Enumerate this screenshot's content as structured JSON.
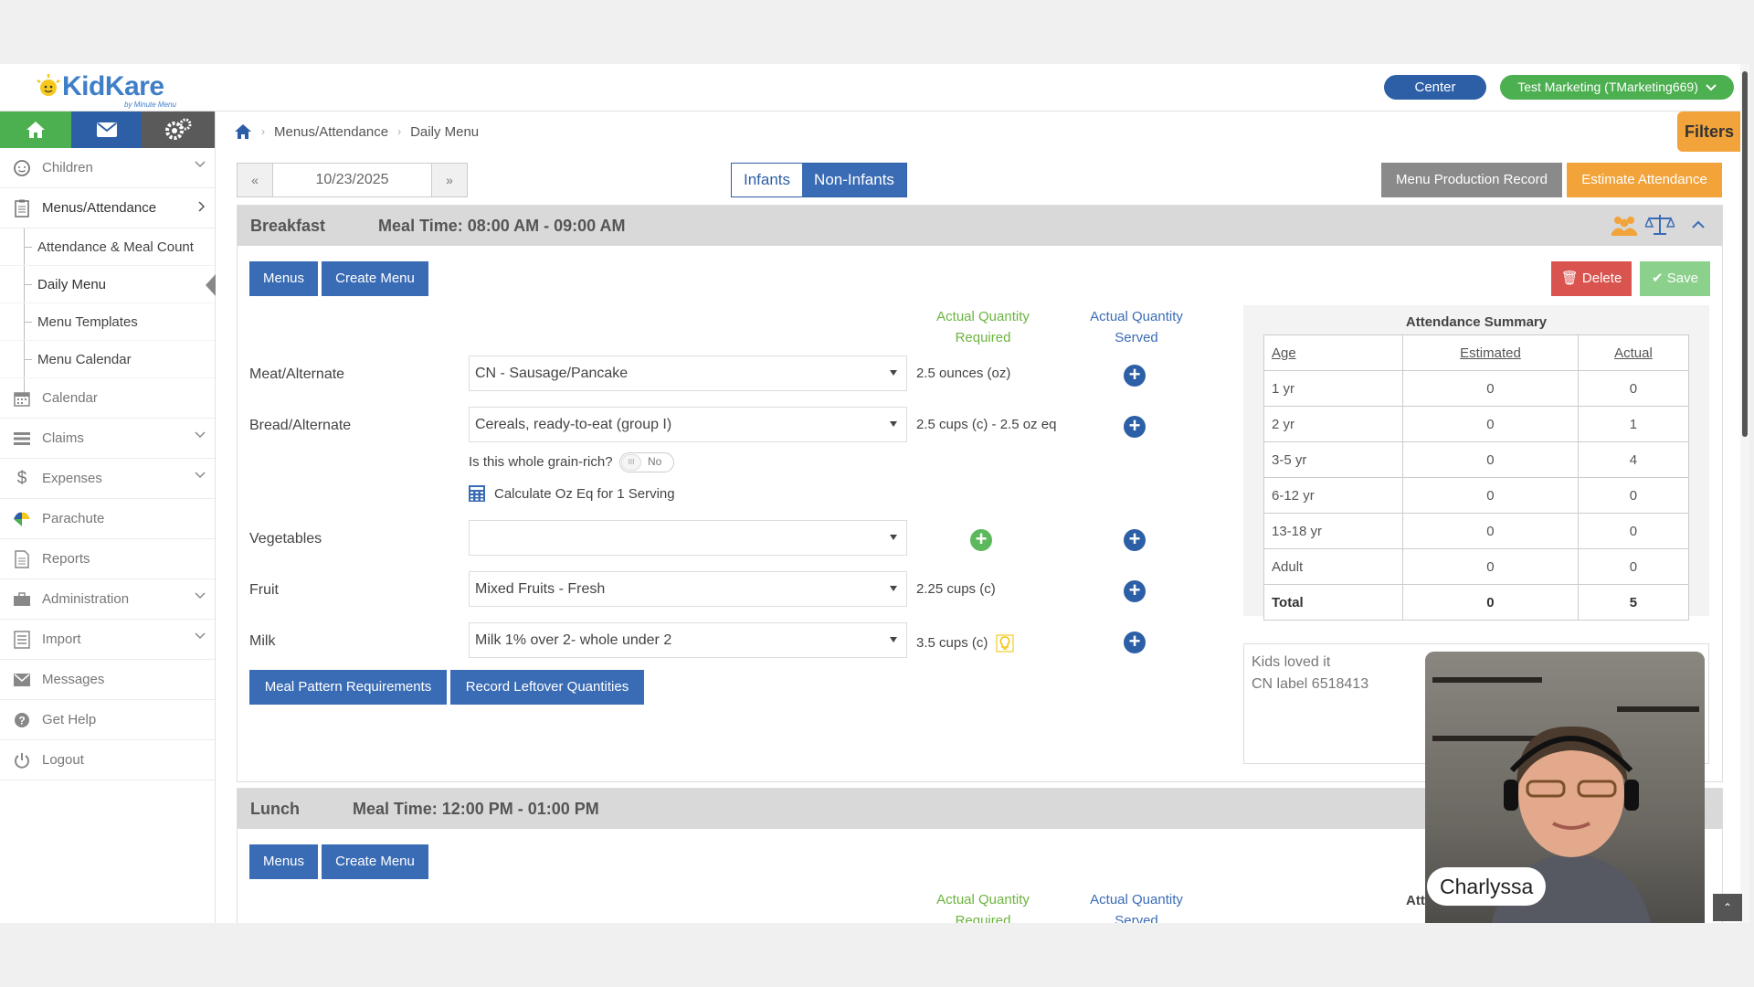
{
  "header": {
    "logo_text": "KidKare",
    "logo_sub": "by Minute Menu",
    "center_label": "Center",
    "account_label": "Test Marketing (TMarketing669)"
  },
  "sidebar": {
    "items": [
      {
        "label": "Children",
        "icon": "child-face-icon",
        "expandable": true
      },
      {
        "label": "Menus/Attendance",
        "icon": "clipboard-icon",
        "expandable": true
      },
      {
        "label": "Calendar",
        "icon": "calendar-icon",
        "expandable": false
      },
      {
        "label": "Claims",
        "icon": "list-icon",
        "expandable": true
      },
      {
        "label": "Expenses",
        "icon": "dollar-icon",
        "expandable": true
      },
      {
        "label": "Parachute",
        "icon": "parachute-icon",
        "expandable": false
      },
      {
        "label": "Reports",
        "icon": "report-icon",
        "expandable": false
      },
      {
        "label": "Administration",
        "icon": "briefcase-icon",
        "expandable": true
      },
      {
        "label": "Import",
        "icon": "import-icon",
        "expandable": true
      },
      {
        "label": "Messages",
        "icon": "envelope-icon",
        "expandable": false
      },
      {
        "label": "Get Help",
        "icon": "question-icon",
        "expandable": false
      },
      {
        "label": "Logout",
        "icon": "power-icon",
        "expandable": false
      }
    ],
    "subitems": [
      "Attendance & Meal Count",
      "Daily Menu",
      "Menu Templates",
      "Menu Calendar"
    ]
  },
  "breadcrumb": {
    "items": [
      "Menus/Attendance",
      "Daily Menu"
    ]
  },
  "filters_label": "Filters",
  "toolbar": {
    "date": "10/23/2025",
    "infants_label": "Infants",
    "noninfants_label": "Non-Infants",
    "mpr_label": "Menu Production Record",
    "estimate_label": "Estimate Attendance"
  },
  "breakfast": {
    "title": "Breakfast",
    "meal_time": "Meal Time: 08:00 AM - 09:00 AM",
    "menus_label": "Menus",
    "create_menu_label": "Create Menu",
    "delete_label": "Delete",
    "save_label": "Save",
    "qty_required_header": [
      "Actual Quantity",
      "Required"
    ],
    "qty_served_header": [
      "Actual Quantity",
      "Served"
    ],
    "rows": [
      {
        "label": "Meat/Alternate",
        "value": "CN - Sausage/Pancake",
        "qty": "2.5 ounces (oz)"
      },
      {
        "label": "Bread/Alternate",
        "value": "Cereals, ready-to-eat (group I)",
        "qty": "2.5 cups (c) - 2.5 oz eq"
      },
      {
        "label": "Vegetables",
        "value": "",
        "qty": ""
      },
      {
        "label": "Fruit",
        "value": "Mixed Fruits - Fresh",
        "qty": "2.25 cups (c)"
      },
      {
        "label": "Milk",
        "value": "Milk 1% over 2- whole under 2",
        "qty": "3.5 cups (c)"
      }
    ],
    "grain_question": "Is this whole grain-rich?",
    "grain_toggle": "No",
    "calc_label": "Calculate Oz Eq for 1 Serving",
    "meal_pattern_label": "Meal Pattern Requirements",
    "leftover_label": "Record Leftover Quantities",
    "attendance": {
      "title": "Attendance Summary",
      "headers": [
        "Age",
        "Estimated",
        "Actual"
      ],
      "rows": [
        [
          "1 yr",
          "0",
          "0"
        ],
        [
          "2 yr",
          "0",
          "1"
        ],
        [
          "3-5 yr",
          "0",
          "4"
        ],
        [
          "6-12 yr",
          "0",
          "0"
        ],
        [
          "13-18 yr",
          "0",
          "0"
        ],
        [
          "Adult",
          "0",
          "0"
        ],
        [
          "Total",
          "0",
          "5"
        ]
      ]
    },
    "notes": [
      "Kids loved it",
      "CN label 6518413"
    ]
  },
  "lunch": {
    "title": "Lunch",
    "meal_time": "Meal Time: 12:00 PM - 01:00 PM",
    "menus_label": "Menus",
    "create_menu_label": "Create Menu",
    "qty_required_header": [
      "Actual Quantity",
      "Required"
    ],
    "qty_served_header": [
      "Actual Quantity",
      "Served"
    ],
    "attendance_partial": "Att"
  },
  "video": {
    "name": "Charlyssa"
  },
  "colors": {
    "green": "#4caf50",
    "blue": "#2c5fa6",
    "orange": "#f2a33a",
    "red": "#d9534f"
  }
}
